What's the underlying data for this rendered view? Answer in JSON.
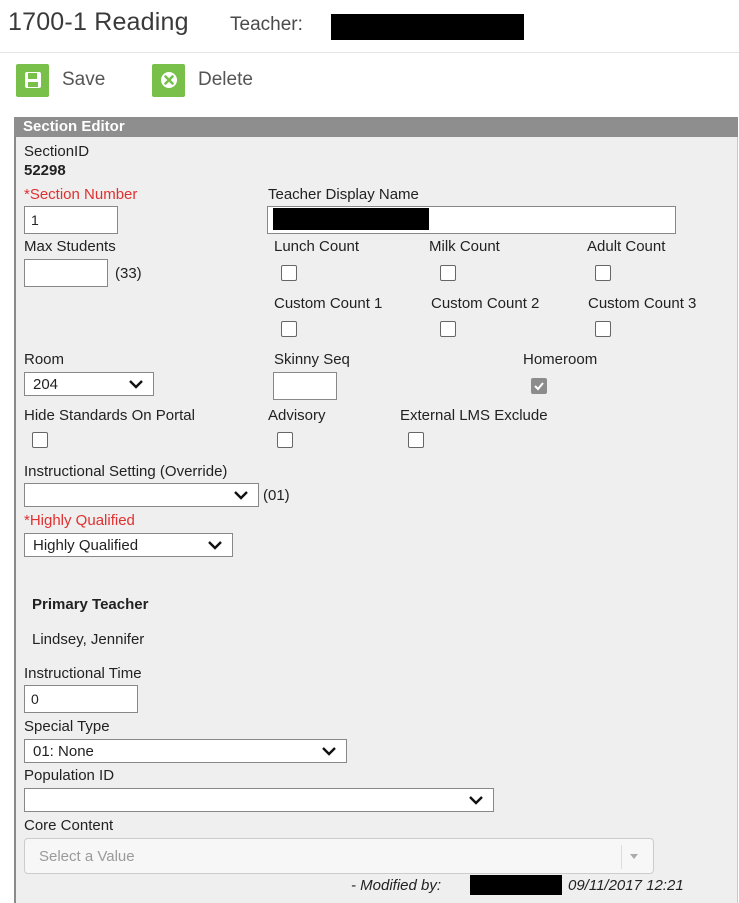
{
  "header": {
    "title": "1700-1 Reading",
    "teacher_label": "Teacher:"
  },
  "toolbar": {
    "save_label": "Save",
    "delete_label": "Delete"
  },
  "panel": {
    "title": "Section Editor",
    "section_id_label": "SectionID",
    "section_id_value": "52298",
    "section_number": {
      "label": "*Section Number",
      "value": "1"
    },
    "teacher_display_name": {
      "label": "Teacher Display Name"
    },
    "max_students": {
      "label": "Max Students",
      "value": "",
      "hint": "(33)"
    },
    "counts": {
      "lunch": "Lunch Count",
      "milk": "Milk Count",
      "adult": "Adult Count",
      "custom1": "Custom Count 1",
      "custom2": "Custom Count 2",
      "custom3": "Custom Count 3"
    },
    "room": {
      "label": "Room",
      "value": "204"
    },
    "skinny_seq": {
      "label": "Skinny Seq",
      "value": ""
    },
    "homeroom": {
      "label": "Homeroom",
      "checked": true
    },
    "hide_standards": {
      "label": "Hide Standards On Portal"
    },
    "advisory": {
      "label": "Advisory"
    },
    "external_lms": {
      "label": "External LMS Exclude"
    },
    "instructional_setting": {
      "label": "Instructional Setting (Override)",
      "value": "",
      "hint": "(01)"
    },
    "highly_qualified": {
      "label": "*Highly Qualified",
      "value": "Highly Qualified"
    },
    "primary_teacher": {
      "label": "Primary Teacher",
      "value": "Lindsey, Jennifer"
    },
    "instructional_time": {
      "label": "Instructional Time",
      "value": "0"
    },
    "special_type": {
      "label": "Special Type",
      "value": "01: None"
    },
    "population_id": {
      "label": "Population ID",
      "value": ""
    },
    "core_content": {
      "label": "Core Content",
      "placeholder": "Select a Value"
    },
    "modified": {
      "prefix": "- Modified by:",
      "timestamp": "09/11/2017 12:21"
    }
  },
  "colors": {
    "accent_green": "#78c04a",
    "required_red": "#e03030",
    "panel_header": "#8e8e8e",
    "panel_bg": "#efefef"
  },
  "icons": [
    "save-icon",
    "delete-icon",
    "chevron-down-icon",
    "checkmark-icon"
  ]
}
